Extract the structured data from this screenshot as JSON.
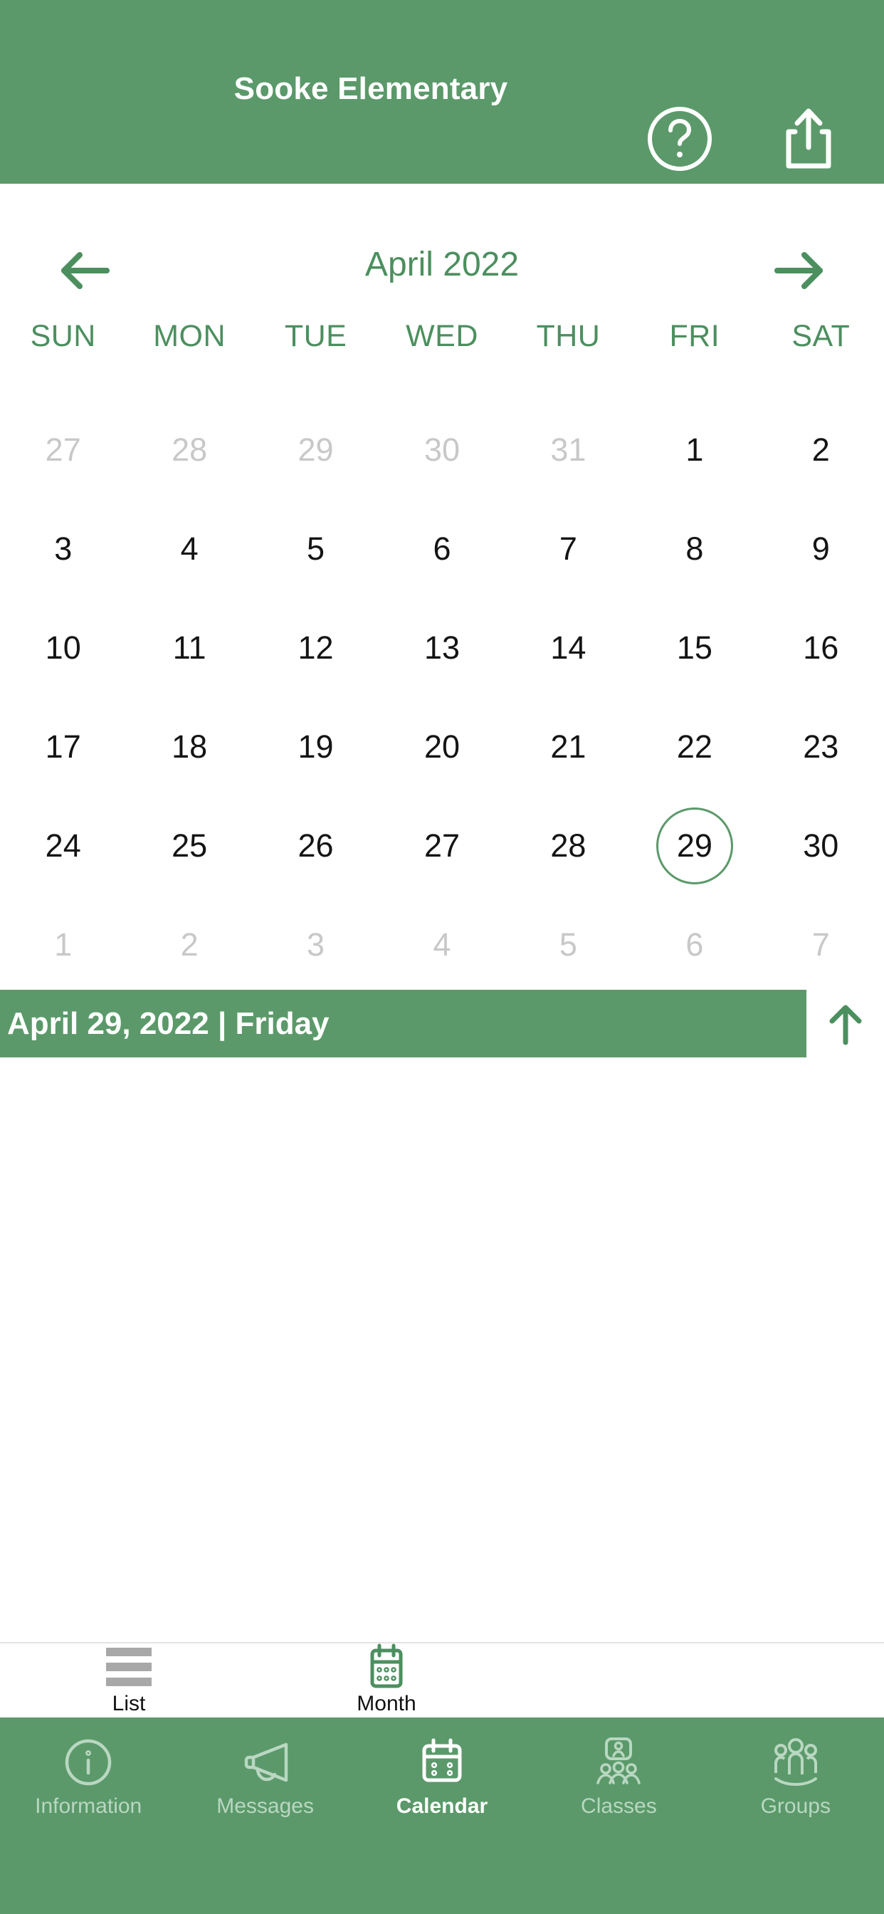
{
  "colors": {
    "brand_green": "#5B996A",
    "month_label_green": "#4C8F5F",
    "muted_day": "#c8c8c8",
    "active_day": "#141414",
    "inactive_tab": "#b9d7c1"
  },
  "header": {
    "title": "Sooke Elementary",
    "help_icon": "question-circle-icon",
    "share_icon": "share-icon"
  },
  "month_nav": {
    "prev_icon": "arrow-left-icon",
    "next_icon": "arrow-right-icon",
    "month_label": "April 2022"
  },
  "calendar": {
    "weekdays": [
      "SUN",
      "MON",
      "TUE",
      "WED",
      "THU",
      "FRI",
      "SAT"
    ],
    "selected_day": 29,
    "weeks": [
      [
        {
          "n": "27",
          "muted": true
        },
        {
          "n": "28",
          "muted": true
        },
        {
          "n": "29",
          "muted": true
        },
        {
          "n": "30",
          "muted": true
        },
        {
          "n": "31",
          "muted": true
        },
        {
          "n": "1",
          "muted": false
        },
        {
          "n": "2",
          "muted": false
        }
      ],
      [
        {
          "n": "3",
          "muted": false
        },
        {
          "n": "4",
          "muted": false
        },
        {
          "n": "5",
          "muted": false
        },
        {
          "n": "6",
          "muted": false
        },
        {
          "n": "7",
          "muted": false
        },
        {
          "n": "8",
          "muted": false
        },
        {
          "n": "9",
          "muted": false
        }
      ],
      [
        {
          "n": "10",
          "muted": false
        },
        {
          "n": "11",
          "muted": false
        },
        {
          "n": "12",
          "muted": false
        },
        {
          "n": "13",
          "muted": false
        },
        {
          "n": "14",
          "muted": false
        },
        {
          "n": "15",
          "muted": false
        },
        {
          "n": "16",
          "muted": false
        }
      ],
      [
        {
          "n": "17",
          "muted": false
        },
        {
          "n": "18",
          "muted": false
        },
        {
          "n": "19",
          "muted": false
        },
        {
          "n": "20",
          "muted": false
        },
        {
          "n": "21",
          "muted": false
        },
        {
          "n": "22",
          "muted": false
        },
        {
          "n": "23",
          "muted": false
        }
      ],
      [
        {
          "n": "24",
          "muted": false
        },
        {
          "n": "25",
          "muted": false
        },
        {
          "n": "26",
          "muted": false
        },
        {
          "n": "27",
          "muted": false
        },
        {
          "n": "28",
          "muted": false
        },
        {
          "n": "29",
          "muted": false,
          "selected": true
        },
        {
          "n": "30",
          "muted": false
        }
      ],
      [
        {
          "n": "1",
          "muted": true
        },
        {
          "n": "2",
          "muted": true
        },
        {
          "n": "3",
          "muted": true
        },
        {
          "n": "4",
          "muted": true
        },
        {
          "n": "5",
          "muted": true
        },
        {
          "n": "6",
          "muted": true
        },
        {
          "n": "7",
          "muted": true
        }
      ]
    ]
  },
  "date_banner": {
    "text": "April 29, 2022 | Friday",
    "collapse_icon": "arrow-up-icon"
  },
  "events": {
    "items": []
  },
  "view_switch": {
    "items": [
      {
        "label": "List",
        "icon": "list-icon",
        "active": false
      },
      {
        "label": "Month",
        "icon": "calendar-icon",
        "active": true
      }
    ]
  },
  "tab_bar": {
    "items": [
      {
        "label": "Information",
        "icon": "info-circle-icon",
        "active": false
      },
      {
        "label": "Messages",
        "icon": "megaphone-icon",
        "active": false
      },
      {
        "label": "Calendar",
        "icon": "calendar-icon",
        "active": true
      },
      {
        "label": "Classes",
        "icon": "classroom-icon",
        "active": false
      },
      {
        "label": "Groups",
        "icon": "people-group-icon",
        "active": false
      }
    ]
  }
}
